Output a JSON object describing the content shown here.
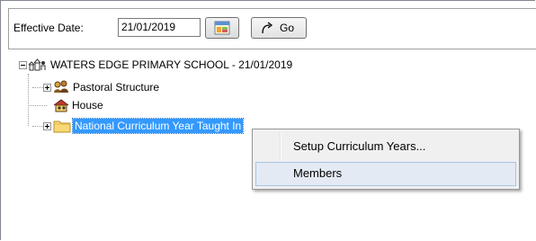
{
  "toolbar": {
    "effective_date_label": "Effective Date:",
    "effective_date_value": "21/01/2019",
    "calendar_icon": "calendar-icon",
    "go_label": "Go",
    "go_icon": "go-arrow-icon"
  },
  "tree": {
    "root": {
      "label": "WATERS EDGE PRIMARY SCHOOL - 21/01/2019",
      "icon": "school-icon",
      "expanded": true
    },
    "children": [
      {
        "label": "Pastoral Structure",
        "icon": "pastoral-group-icon",
        "expandable": true
      },
      {
        "label": "House",
        "icon": "house-group-icon",
        "expandable": false
      },
      {
        "label": "National Curriculum Year Taught In",
        "icon": "folder-icon",
        "expandable": true,
        "selected": true
      }
    ]
  },
  "context_menu": {
    "items": [
      {
        "label": "Setup Curriculum Years...",
        "hover": false
      },
      {
        "label": "Members",
        "hover": true
      }
    ]
  },
  "colors": {
    "selection": "#3399ff",
    "menu_background": "#f0f0f0",
    "menu_hover": "#e4eaf3"
  }
}
